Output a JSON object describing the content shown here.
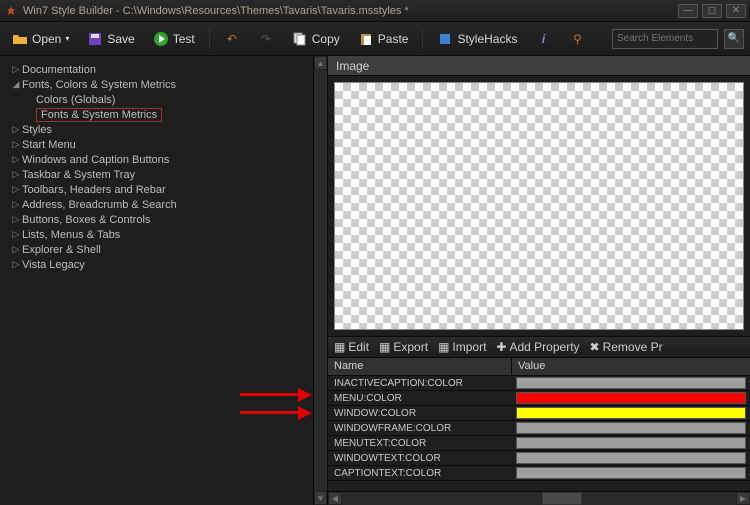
{
  "titlebar": {
    "title": "Win7 Style Builder - C:\\Windows\\Resources\\Themes\\Tavaris\\Tavaris.msstyles *"
  },
  "toolbar": {
    "open": "Open",
    "save": "Save",
    "test": "Test",
    "copy": "Copy",
    "paste": "Paste",
    "stylehacks": "StyleHacks",
    "search_placeholder": "Search Elements"
  },
  "tree": {
    "items": [
      {
        "label": "Documentation",
        "level": 0,
        "arrow": "▷"
      },
      {
        "label": "Fonts, Colors & System Metrics",
        "level": 0,
        "arrow": "◢"
      },
      {
        "label": "Colors (Globals)",
        "level": 1,
        "arrow": ""
      },
      {
        "label": "Fonts & System Metrics",
        "level": 1,
        "arrow": "",
        "selected": true
      },
      {
        "label": "Styles",
        "level": 0,
        "arrow": "▷"
      },
      {
        "label": "Start Menu",
        "level": 0,
        "arrow": "▷"
      },
      {
        "label": "Windows and Caption Buttons",
        "level": 0,
        "arrow": "▷"
      },
      {
        "label": "Taskbar & System Tray",
        "level": 0,
        "arrow": "▷"
      },
      {
        "label": "Toolbars, Headers and Rebar",
        "level": 0,
        "arrow": "▷"
      },
      {
        "label": "Address, Breadcrumb & Search",
        "level": 0,
        "arrow": "▷"
      },
      {
        "label": "Buttons, Boxes & Controls",
        "level": 0,
        "arrow": "▷"
      },
      {
        "label": "Lists, Menus & Tabs",
        "level": 0,
        "arrow": "▷"
      },
      {
        "label": "Explorer & Shell",
        "level": 0,
        "arrow": "▷"
      },
      {
        "label": "Vista Legacy",
        "level": 0,
        "arrow": "▷"
      }
    ]
  },
  "imagepanel": {
    "title": "Image"
  },
  "proptoolbar": {
    "edit": "Edit",
    "export": "Export",
    "import": "Import",
    "addprop": "Add Property",
    "removepr": "Remove Pr"
  },
  "propgrid": {
    "col_name": "Name",
    "col_value": "Value",
    "rows": [
      {
        "name": "INACTIVECAPTION:COLOR",
        "color": "#9e9e9e"
      },
      {
        "name": "MENU:COLOR",
        "color": "#ff0000"
      },
      {
        "name": "WINDOW:COLOR",
        "color": "#ffff00"
      },
      {
        "name": "WINDOWFRAME:COLOR",
        "color": "#9e9e9e"
      },
      {
        "name": "MENUTEXT:COLOR",
        "color": "#9e9e9e"
      },
      {
        "name": "WINDOWTEXT:COLOR",
        "color": "#9e9e9e"
      },
      {
        "name": "CAPTIONTEXT:COLOR",
        "color": "#9e9e9e"
      }
    ]
  }
}
